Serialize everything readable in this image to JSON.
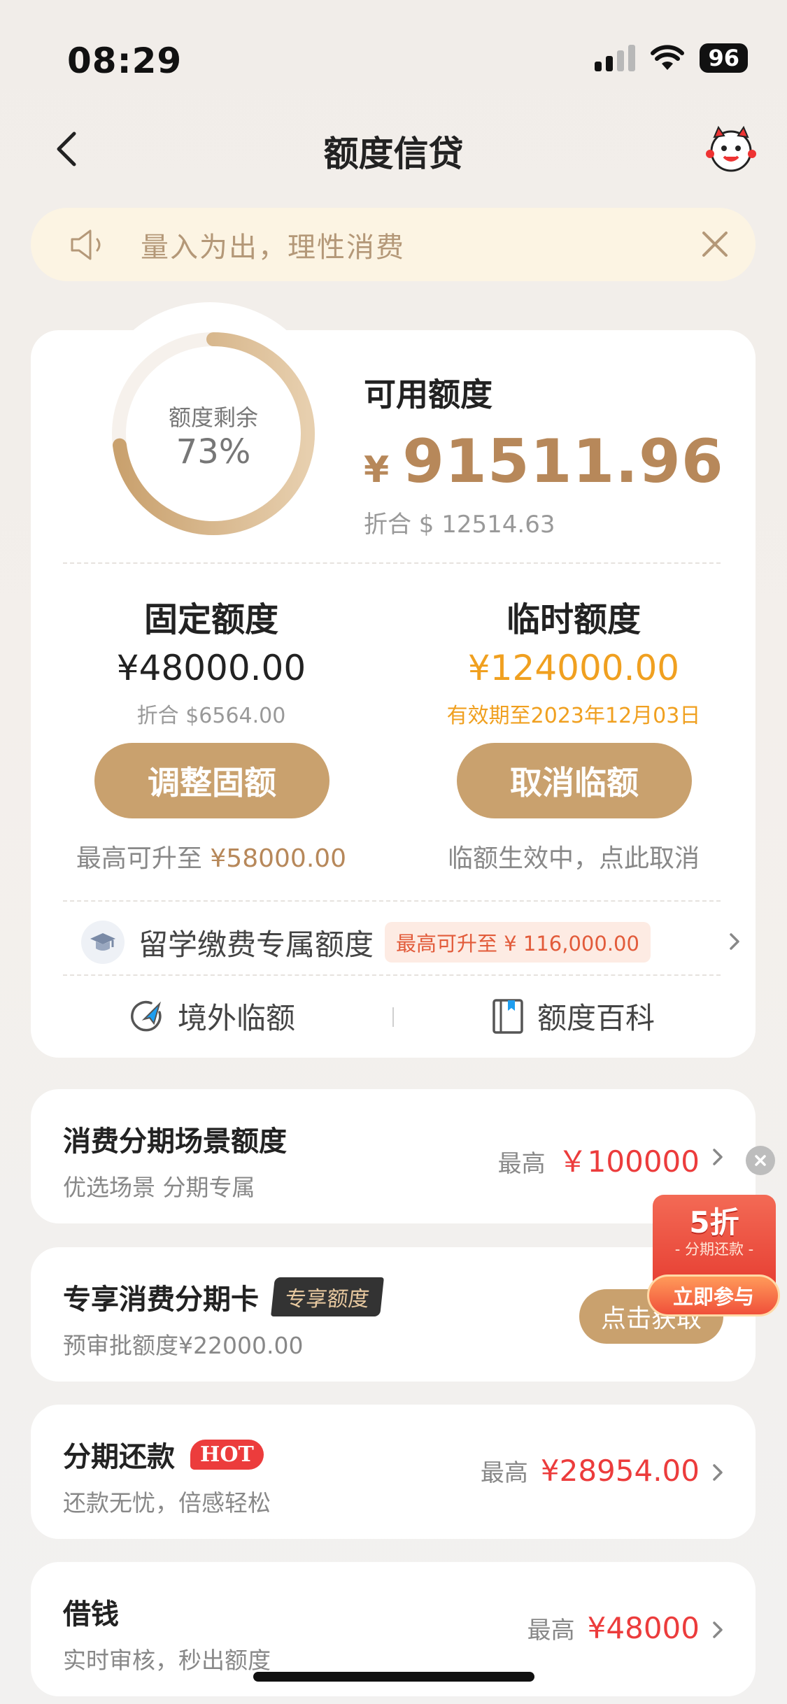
{
  "status_bar": {
    "time": "08:29",
    "battery": "96"
  },
  "nav": {
    "title": "额度信贷"
  },
  "notice": {
    "text": "量入为出，理性消费"
  },
  "credit": {
    "ring_label": "额度剩余",
    "ring_percent": "73%",
    "ring_fraction": 0.73,
    "available_title": "可用额度",
    "currency": "¥",
    "available_amount": "91511.96",
    "available_usd": "折合 $ 12514.63"
  },
  "fixed": {
    "title": "固定额度",
    "amount": "¥48000.00",
    "usd": "折合 $6564.00",
    "button": "调整固额",
    "note_prefix": "最高可升至",
    "note_value": "¥58000.00"
  },
  "temporary": {
    "title": "临时额度",
    "amount": "¥124000.00",
    "valid": "有效期至2023年12月03日",
    "button": "取消临额",
    "note": "临额生效中，点此取消"
  },
  "study": {
    "label": "留学缴费专属额度",
    "badge": "最高可升至 ¥ 116,000.00"
  },
  "quick_links": [
    {
      "label": "境外临额"
    },
    {
      "label": "额度百科"
    }
  ],
  "list": [
    {
      "title": "消费分期场景额度",
      "sub": "优选场景 分期专属",
      "prefix": "最高",
      "value": "￥100000"
    },
    {
      "title": "专享消费分期卡",
      "tag": "专享额度",
      "sub": "预审批额度¥22000.00",
      "button": "点击获取"
    },
    {
      "title": "分期还款",
      "tag": "HOT",
      "sub": "还款无忧，倍感轻松",
      "prefix": "最高",
      "value": "¥28954.00"
    },
    {
      "title": "借钱",
      "sub": "实时审核，秒出额度",
      "prefix": "最高",
      "value": "¥48000"
    }
  ],
  "promo": {
    "big": "5折",
    "small": "- 分期还款 -",
    "button": "立即参与"
  },
  "colors": {
    "gold": "#c9a16e",
    "red": "#ec3c3c",
    "orange": "#f0a020"
  }
}
